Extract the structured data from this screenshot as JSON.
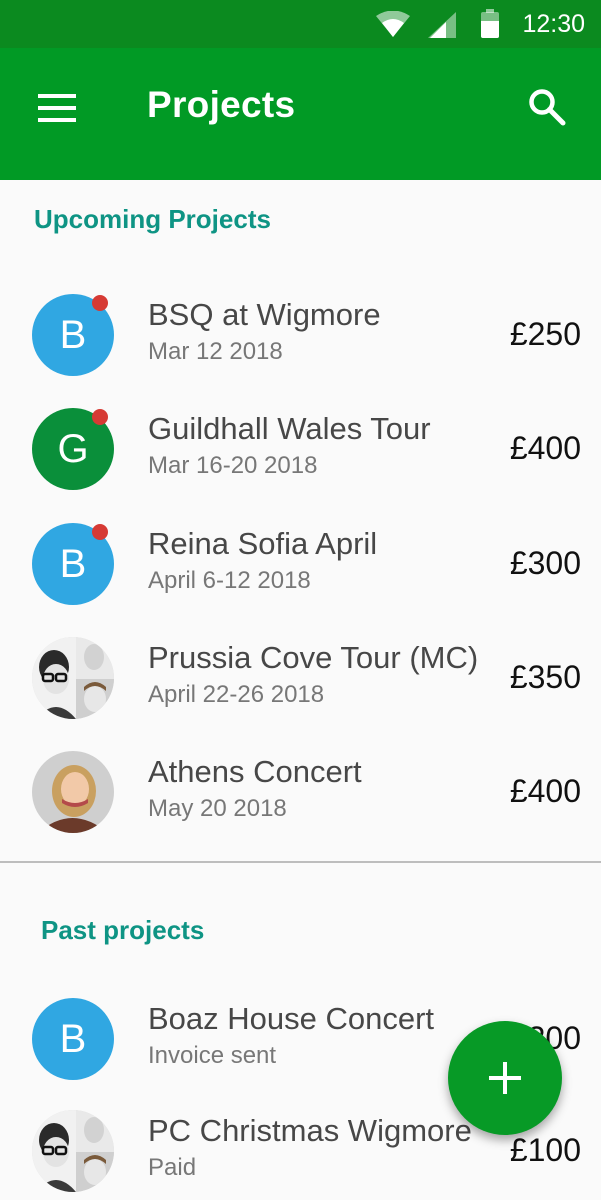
{
  "status_bar": {
    "time": "12:30",
    "icons": [
      "wifi-icon",
      "signal-icon",
      "battery-icon"
    ]
  },
  "app_bar": {
    "title": "Projects",
    "menu_icon": "menu-icon",
    "search_icon": "search-icon"
  },
  "upcoming": {
    "title": "Upcoming Projects",
    "items": [
      {
        "avatar_letter": "B",
        "avatar_color": "#30a7e2",
        "notification_dot": true,
        "title": "BSQ at Wigmore",
        "subtitle": "Mar 12 2018",
        "amount": "£250"
      },
      {
        "avatar_letter": "G",
        "avatar_color": "#0a8f3a",
        "notification_dot": true,
        "title": "Guildhall Wales Tour",
        "subtitle": "Mar 16-20 2018",
        "amount": "£400"
      },
      {
        "avatar_letter": "B",
        "avatar_color": "#30a7e2",
        "notification_dot": true,
        "title": "Reina Sofia April",
        "subtitle": "April 6-12 2018",
        "amount": "£300"
      },
      {
        "avatar_type": "group-photo",
        "title": "Prussia Cove Tour (MC)",
        "subtitle": "April 22-26 2018",
        "amount": "£350"
      },
      {
        "avatar_type": "person-photo",
        "title": "Athens Concert",
        "subtitle": "May 20 2018",
        "amount": "£400"
      }
    ]
  },
  "past": {
    "title": "Past projects",
    "items": [
      {
        "avatar_letter": "B",
        "avatar_color": "#30a7e2",
        "title": "Boaz House Concert",
        "subtitle": "Invoice sent",
        "amount": "£200"
      },
      {
        "avatar_type": "group-photo",
        "title": "PC Christmas Wigmore",
        "subtitle": "Paid",
        "amount": "£100"
      }
    ]
  },
  "fab": {
    "icon": "plus-icon"
  },
  "colors": {
    "status_bar": "#0b8a1f",
    "app_bar": "#019a25",
    "accent": "#0e9484",
    "fab": "#079a26",
    "dot": "#d63a34"
  }
}
